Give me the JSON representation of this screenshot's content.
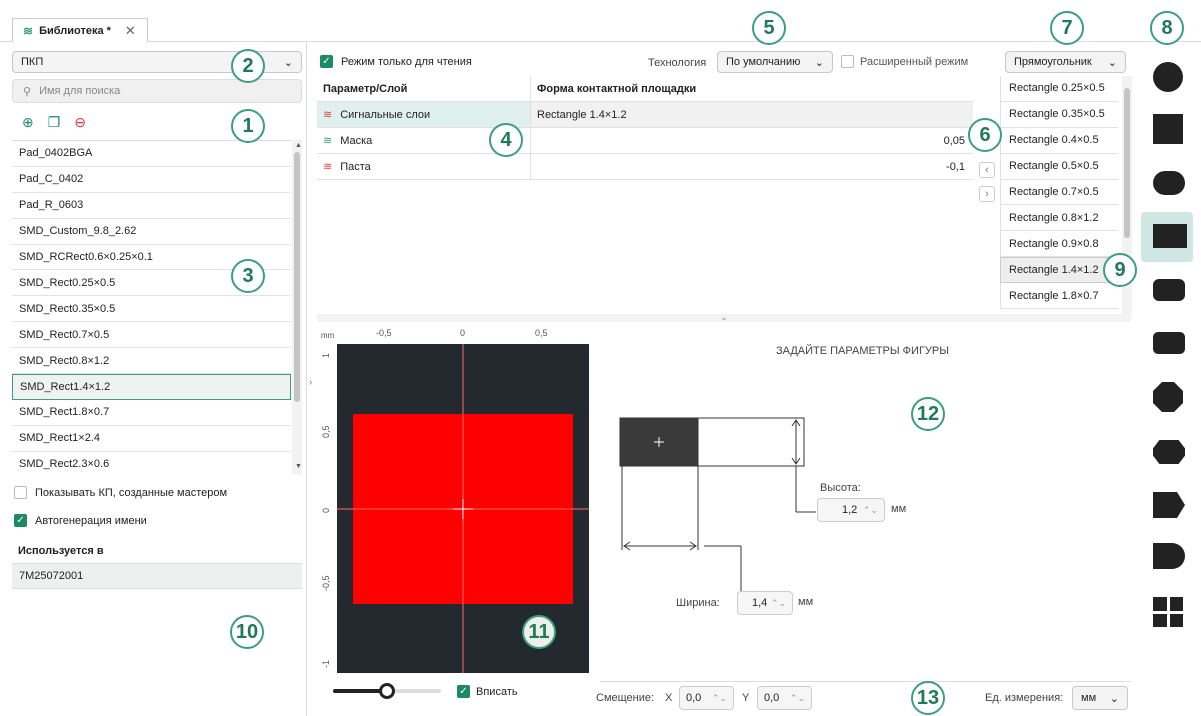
{
  "tab": {
    "title": "Библиотека *",
    "close": "✕"
  },
  "left": {
    "type_select": "ПКП",
    "search_placeholder": "Имя для поиска",
    "pads": [
      "Pad_0402BGA",
      "Pad_C_0402",
      "Pad_R_0603",
      "SMD_Custom_9.8_2.62",
      "SMD_RCRect0.6×0.25×0.1",
      "SMD_Rect0.25×0.5",
      "SMD_Rect0.35×0.5",
      "SMD_Rect0.7×0.5",
      "SMD_Rect0.8×1.2",
      "SMD_Rect1.4×1.2",
      "SMD_Rect1.8×0.7",
      "SMD_Rect1×2.4",
      "SMD_Rect2.3×0.6"
    ],
    "selected_index": 9,
    "show_wizard": "Показывать КП, созданные мастером",
    "autoname": "Автогенерация имени",
    "used_in_title": "Используется в",
    "used_in_item": "7M25072001"
  },
  "toolbar": {
    "readonly": "Режим только для чтения",
    "tech_label": "Технология",
    "tech_value": "По умолчанию",
    "advanced": "Расширенный режим",
    "shape_value": "Прямоугольник"
  },
  "table": {
    "headers": [
      "Параметр/Слой",
      "Форма контактной площадки"
    ],
    "rows": [
      {
        "layer": "Сигнальные слои",
        "value": "Rectangle 1.4×1.2"
      },
      {
        "layer": "Маска",
        "value": "0,05"
      },
      {
        "layer": "Паста",
        "value": "-0,1"
      }
    ]
  },
  "shapes": [
    "Rectangle 0.25×0.5",
    "Rectangle 0.35×0.5",
    "Rectangle 0.4×0.5",
    "Rectangle 0.5×0.5",
    "Rectangle 0.7×0.5",
    "Rectangle 0.8×1.2",
    "Rectangle 0.9×0.8",
    "Rectangle 1.4×1.2",
    "Rectangle 1.8×0.7"
  ],
  "preview": {
    "unit": "mm",
    "xticks": [
      "-0,5",
      "0",
      "0,5"
    ],
    "yticks": [
      "1",
      "0,5",
      "0",
      "-0,5",
      "-1"
    ],
    "fit": "Вписать",
    "zoom_fraction": 0.5,
    "pad_color": "#ff0000",
    "bg_color": "#24292f"
  },
  "params": {
    "title": "ЗАДАЙТЕ ПАРАМЕТРЫ ФИГУРЫ",
    "height_label": "Высота:",
    "height_value": "1,2",
    "width_label": "Ширина:",
    "width_value": "1,4",
    "unit": "мм"
  },
  "bottom": {
    "offset_label": "Смещение:",
    "x_label": "X",
    "x_value": "0,0",
    "y_label": "Y",
    "y_value": "0,0",
    "units_label": "Ед. измерения:",
    "units_value": "мм"
  },
  "badges": {
    "b1": "1",
    "b2": "2",
    "b3": "3",
    "b4": "4",
    "b5": "5",
    "b6": "6",
    "b7": "7",
    "b8": "8",
    "b9": "9",
    "b10": "10",
    "b11": "11",
    "b12": "12",
    "b13": "13"
  },
  "icons": {
    "layers": "layers-icon",
    "add": "add-icon",
    "copy": "copy-icon",
    "remove": "remove-icon"
  },
  "accent": "#1c8a63"
}
